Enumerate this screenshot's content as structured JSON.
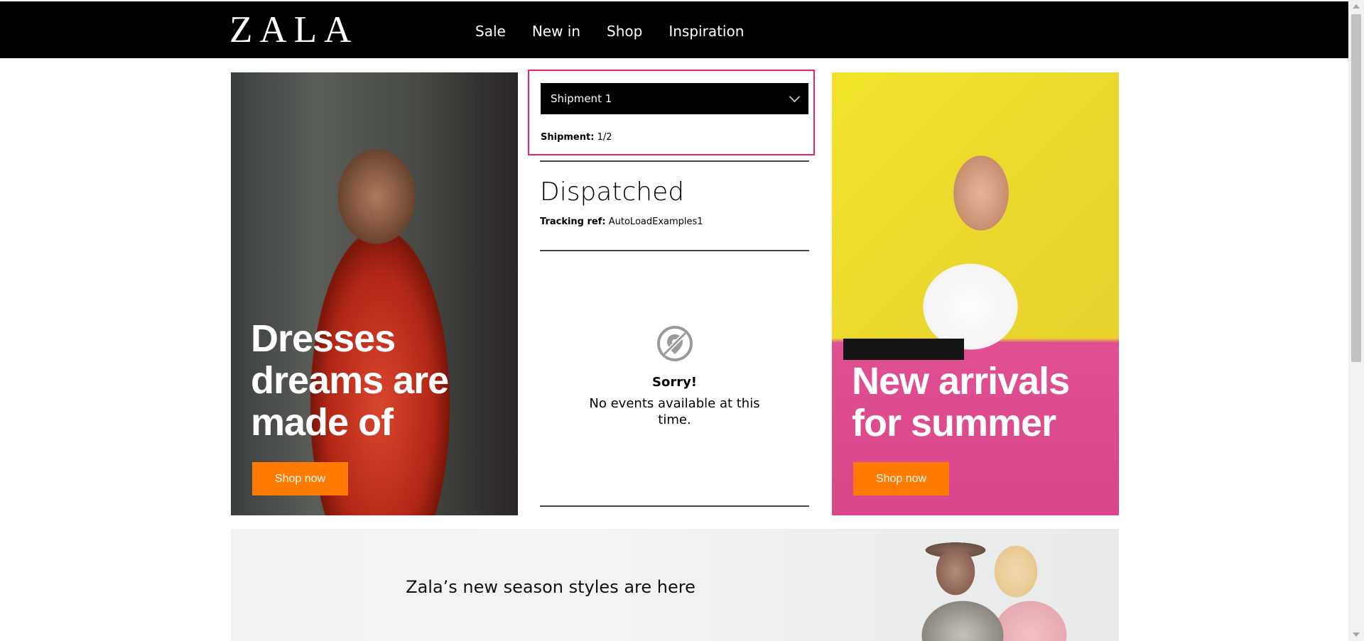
{
  "header": {
    "logo": "ZALA",
    "nav": [
      "Sale",
      "New in",
      "Shop",
      "Inspiration"
    ]
  },
  "promos": [
    {
      "headline": "Dresses dreams are made of",
      "button": "Shop now"
    },
    {
      "headline": "New arrivals for summer",
      "button": "Shop now"
    }
  ],
  "shipment": {
    "selected": "Shipment 1",
    "count_label": "Shipment:",
    "count_value": "1/2"
  },
  "tracking": {
    "status": "Dispatched",
    "ref_label": "Tracking ref:",
    "ref_value": "AutoLoadExamples1"
  },
  "events": {
    "icon": "location-off-icon",
    "title": "Sorry!",
    "message": "No events available at this time."
  },
  "banner": {
    "text": "Zala’s new season styles are here"
  },
  "colors": {
    "accent_button": "#ff7a00",
    "highlight_border": "#e5226c",
    "header_bg": "#000000"
  }
}
